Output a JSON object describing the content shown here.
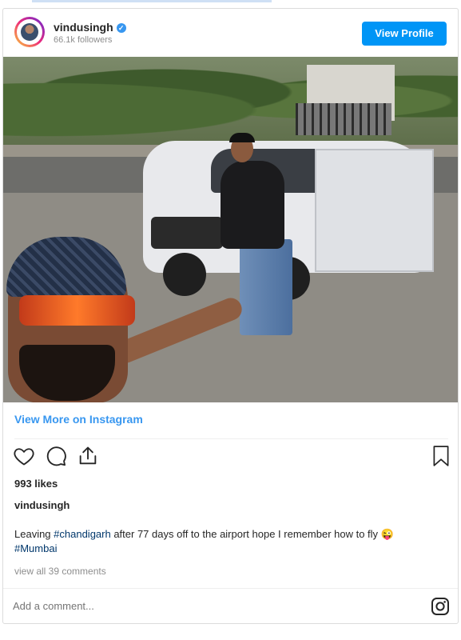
{
  "post": {
    "username": "vindusingh",
    "followers": "66.1k followers",
    "view_profile_label": "View Profile",
    "view_more_label": "View More on Instagram",
    "likes": "993 likes",
    "caption_user": "vindusingh",
    "caption_text_before": "Leaving ",
    "caption_tag1": "#chandigarh",
    "caption_text_after": " after 77 days off to the airport hope I remember how to fly 😜",
    "caption_tag2": "#Mumbai",
    "view_comments": "view all 39 comments",
    "comment_placeholder": "Add a comment..."
  },
  "icons": {
    "like": "heart-icon",
    "comment": "comment-icon",
    "share": "share-icon",
    "save": "bookmark-icon",
    "instagram": "instagram-icon",
    "verified": "verified-badge-icon"
  },
  "colors": {
    "accent": "#0095f6",
    "link": "#3897f0",
    "hashtag": "#00376b",
    "muted": "#8e8e8e"
  }
}
